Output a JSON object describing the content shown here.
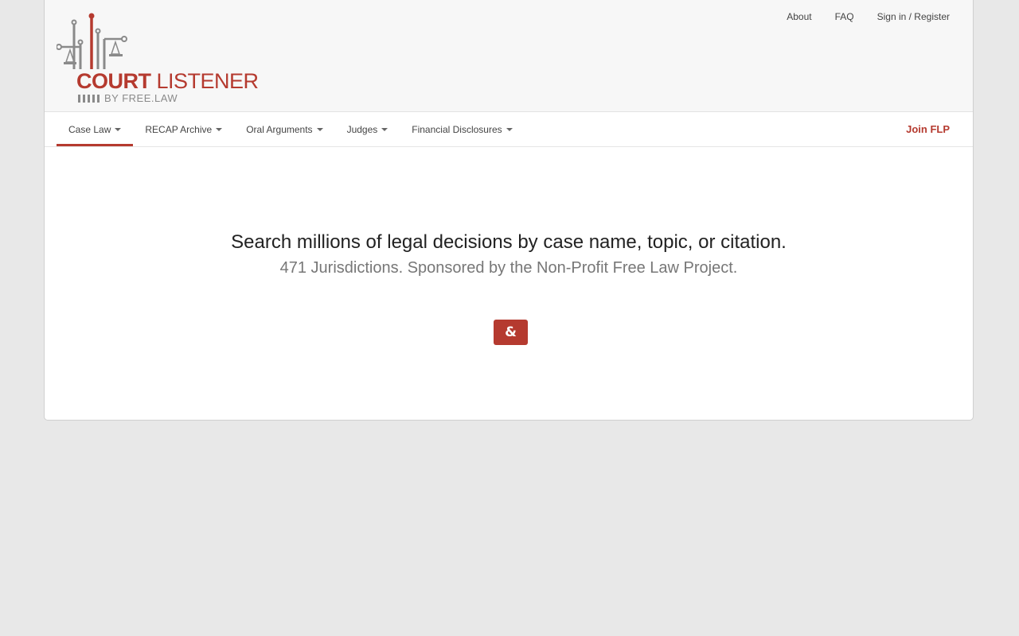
{
  "brand": {
    "name_part1": "COURT",
    "name_part2": " LISTENER",
    "tagline": "BY FREE.LAW",
    "accent_color": "#b53a2f",
    "gray_color": "#8a8a8a"
  },
  "top_links": [
    {
      "label": "About"
    },
    {
      "label": "FAQ"
    },
    {
      "label": "Sign in / Register"
    }
  ],
  "nav": {
    "items": [
      {
        "label": "Case Law",
        "active": true
      },
      {
        "label": "RECAP Archive",
        "active": false
      },
      {
        "label": "Oral Arguments",
        "active": false
      },
      {
        "label": "Judges",
        "active": false
      },
      {
        "label": "Financial Disclosures",
        "active": false
      }
    ],
    "join_label": "Join FLP"
  },
  "hero": {
    "headline": "Search millions of legal decisions by case name, topic, or citation.",
    "subheadline": "471 Jurisdictions. Sponsored by the Non-Profit Free Law Project."
  },
  "search_button": {
    "label": "&"
  }
}
